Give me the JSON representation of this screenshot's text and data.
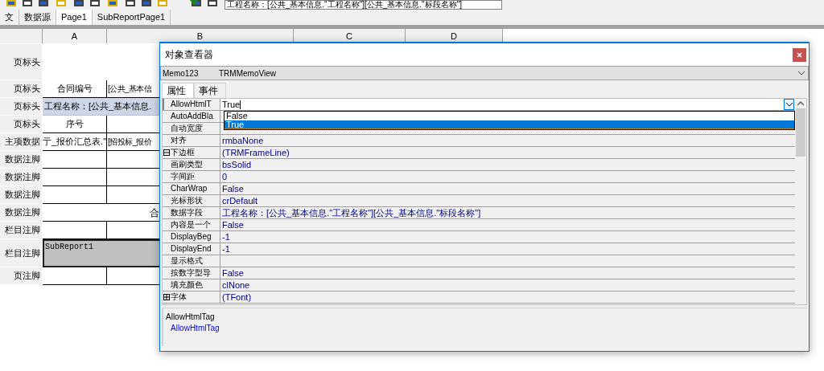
{
  "toolbar": {
    "expression": "工程名称：[公共_基本信息.\"工程名称\"][公共_基本信息.\"标段名称\"]"
  },
  "tabs": [
    {
      "label": "文",
      "selected": false
    },
    {
      "label": "数据源",
      "selected": false
    },
    {
      "label": "Page1",
      "selected": true
    },
    {
      "label": "SubReportPage1",
      "selected": false
    }
  ],
  "columns": [
    "A",
    "B",
    "C",
    "D"
  ],
  "bands": [
    {
      "label": "页标头",
      "kind": "blank_tall"
    },
    {
      "label": "页标头",
      "kind": "cells",
      "cells": [
        "合同编号",
        "[公共_基本信"
      ]
    },
    {
      "label": "页标头",
      "kind": "banner",
      "text": "工程名称：[公共_基本信息."
    },
    {
      "label": "页标头",
      "kind": "cells",
      "cells": [
        "序号",
        ""
      ]
    },
    {
      "label": "主项数据",
      "kind": "cells",
      "cells": [
        "亍_报价汇总表.\"",
        "[招投标_报价"
      ]
    },
    {
      "label": "数据注脚",
      "kind": "cells",
      "cells": [
        "",
        ""
      ]
    },
    {
      "label": "数据注脚",
      "kind": "cells",
      "cells": [
        "",
        ""
      ]
    },
    {
      "label": "数据注脚",
      "kind": "cells",
      "cells": [
        "",
        ""
      ]
    },
    {
      "label": "数据注脚",
      "kind": "merged",
      "text": "合"
    },
    {
      "label": "栏目注脚",
      "kind": "cells",
      "cells": [
        "",
        ""
      ]
    },
    {
      "label": "栏目注脚",
      "kind": "subreport",
      "text": "SubReport1"
    },
    {
      "label": "页注脚",
      "kind": "cells",
      "cells": [
        "",
        ""
      ]
    }
  ],
  "inspector": {
    "title": "对象查看器",
    "object_name": "Memo123",
    "object_type": "TRMMemoView",
    "tabs": [
      {
        "label": "属性",
        "selected": true
      },
      {
        "label": "事件",
        "selected": false
      }
    ],
    "properties": [
      {
        "name": "AllowHtmlT",
        "value": "True",
        "kind": "editing"
      },
      {
        "name": "AutoAddBla",
        "kind": "plain"
      },
      {
        "name": "自动宽度",
        "kind": "plain"
      },
      {
        "name": "对齐",
        "value": "rmbaNone",
        "kind": "plain"
      },
      {
        "name": "下边框",
        "value": "(TRMFrameLine)",
        "kind": "group",
        "expanded": true
      },
      {
        "name": "画刷类型",
        "value": "bsSolid",
        "kind": "plain"
      },
      {
        "name": "字间距",
        "value": "0",
        "kind": "plain"
      },
      {
        "name": "CharWrap",
        "value": "False",
        "kind": "plain"
      },
      {
        "name": "光标形状",
        "value": "crDefault",
        "kind": "plain"
      },
      {
        "name": "数据字段",
        "value": "工程名称：[公共_基本信息.\"工程名称\"][公共_基本信息.\"标段名称\"]",
        "kind": "plain"
      },
      {
        "name": "内容是一个",
        "value": "False",
        "kind": "plain"
      },
      {
        "name": "DisplayBeg",
        "value": "-1",
        "kind": "plain"
      },
      {
        "name": "DisplayEnd",
        "value": "-1",
        "kind": "plain"
      },
      {
        "name": "显示格式",
        "kind": "plain"
      },
      {
        "name": "按数字型导",
        "value": "False",
        "kind": "plain"
      },
      {
        "name": "填充颜色",
        "value": "clNone",
        "kind": "plain"
      },
      {
        "name": "字体",
        "value": "(TFont)",
        "kind": "group",
        "expanded": false
      }
    ],
    "dropdown": [
      {
        "label": "False",
        "selected": false
      },
      {
        "label": "True",
        "selected": true
      }
    ],
    "help_title": "AllowHtmlTag",
    "help_text": "AllowHtmlTag"
  }
}
